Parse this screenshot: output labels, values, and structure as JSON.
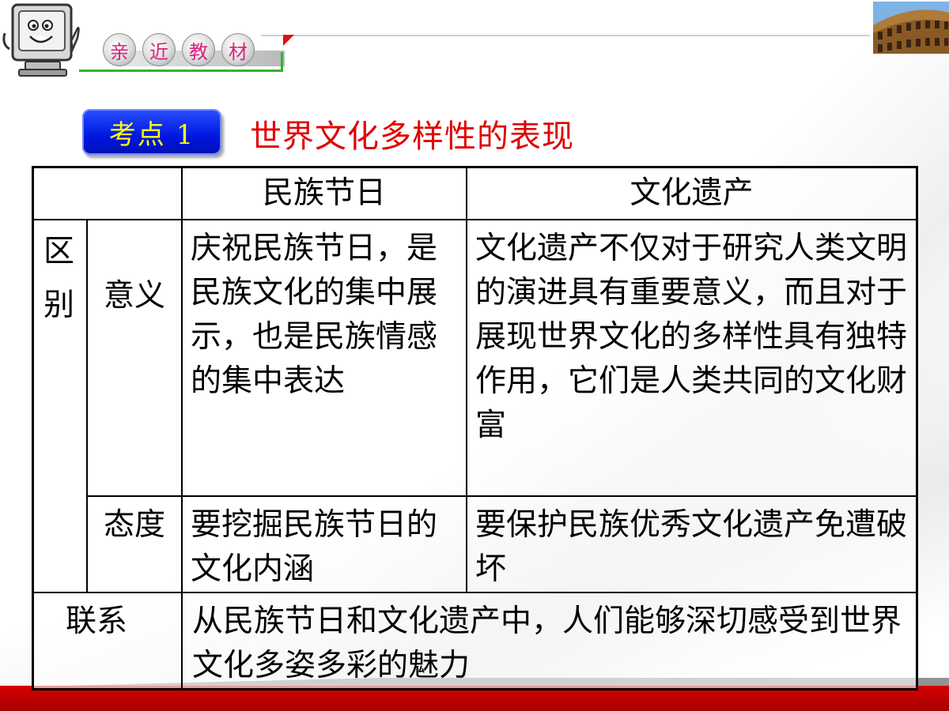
{
  "header": {
    "tabs": [
      "亲",
      "近",
      "教",
      "材"
    ]
  },
  "badge": {
    "label": "考点 1"
  },
  "topic": {
    "title": "世界文化多样性的表现"
  },
  "table": {
    "headers": [
      "民族节日",
      "文化遗产"
    ],
    "group_label": [
      "区",
      "别"
    ],
    "rows": [
      {
        "label": "意义",
        "festival": "庆祝民族节日，是民族文化的集中展示，也是民族情感的集中表达",
        "heritage": "文化遗产不仅对于研究人类文明的演进具有重要意义，而且对于展现世界文化的多样性具有独特作用，它们是人类共同的文化财富"
      },
      {
        "label": "态度",
        "festival": "要挖掘民族节日的文化内涵",
        "heritage": "要保护民族优秀文化遗产免遭破坏"
      }
    ],
    "relation": {
      "label": "联系",
      "text": "从民族节日和文化遗产中，人们能够深切感受到世界文化多姿多彩的魅力"
    }
  },
  "colors": {
    "badge_bg": "#0016e0",
    "badge_text": "#ffff00",
    "title": "#e00000",
    "tab_text": "#d6237f",
    "bottom_band": "#c00000"
  }
}
